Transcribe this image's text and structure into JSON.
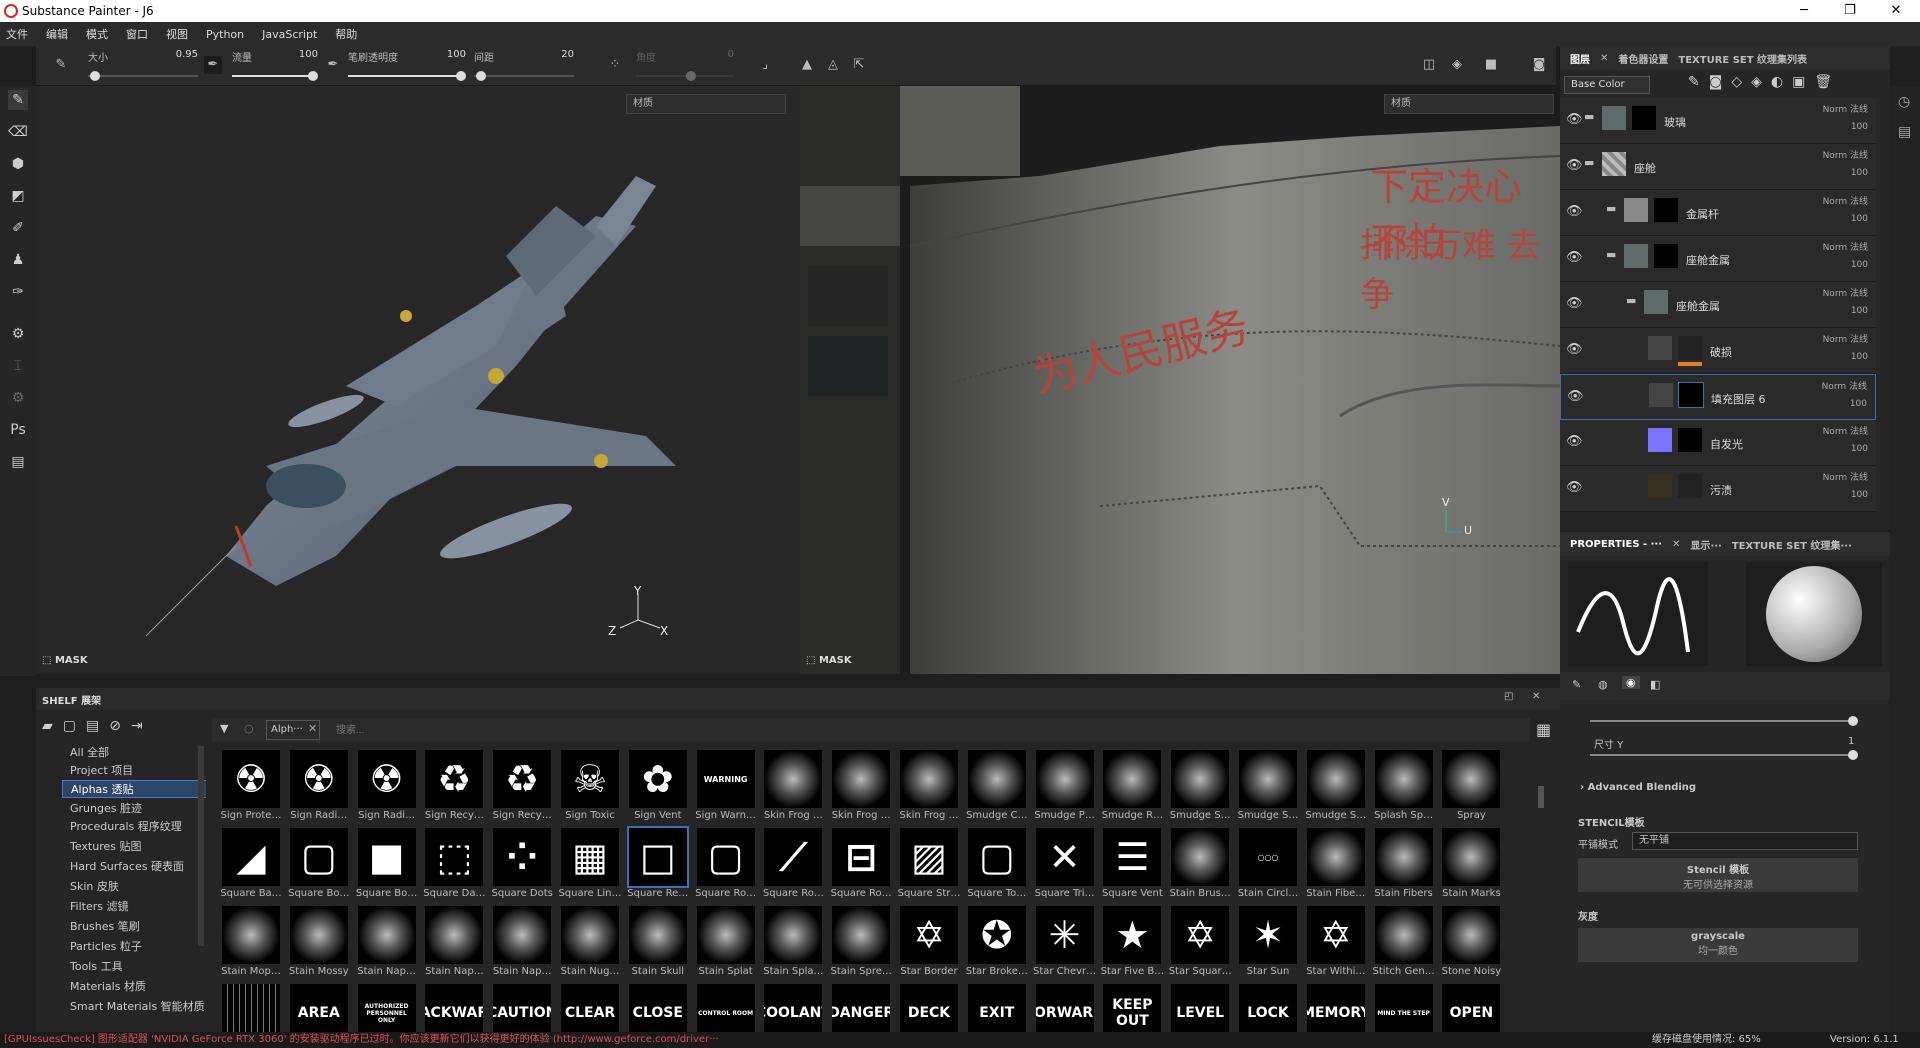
{
  "window": {
    "title": "Substance Painter - J6"
  },
  "menu": [
    "文件",
    "编辑",
    "模式",
    "窗口",
    "视图",
    "Python",
    "JavaScript",
    "帮助"
  ],
  "toolbar": {
    "size_label": "大小",
    "size_value": "0.95",
    "flow_label": "流量",
    "flow_value": "100",
    "stroke_opacity_label": "笔刷透明度",
    "stroke_opacity_value": "100",
    "spacing_label": "间距",
    "spacing_value": "20",
    "angle_label": "角度",
    "angle_value": "0"
  },
  "viewport3d": {
    "material_select": "材质",
    "mask_label": "MASK",
    "axis_y": "Y",
    "axis_x": "X",
    "axis_z": "Z"
  },
  "viewport2d": {
    "material_select": "材质",
    "mask_label": "MASK",
    "axis_v": "V",
    "axis_u": "U",
    "texture_text1": "下定决心  不怕",
    "texture_text2": "排除万难  去争",
    "texture_text3": "为人民服务"
  },
  "layers_panel": {
    "tabs": [
      "图层",
      "着色器设置",
      "TEXTURE SET 纹理集列表"
    ],
    "channel": "Base Color",
    "items": [
      {
        "name": "玻璃",
        "blend": "Norm 法线",
        "opacity": "100"
      },
      {
        "name": "座舱",
        "blend": "Norm 法线",
        "opacity": "100"
      },
      {
        "name": "金属杆",
        "blend": "Norm 法线",
        "opacity": "100"
      },
      {
        "name": "座舱金属",
        "blend": "Norm 法线",
        "opacity": "100"
      },
      {
        "name": "座舱金属",
        "blend": "Norm 法线",
        "opacity": "100"
      },
      {
        "name": "破损",
        "blend": "Norm 法线",
        "opacity": "100"
      },
      {
        "name": "填充图层 6",
        "blend": "Norm 法线",
        "opacity": "100"
      },
      {
        "name": "自发光",
        "blend": "Norm 法线",
        "opacity": "100"
      },
      {
        "name": "污渍",
        "blend": "Norm 法线",
        "opacity": "100"
      }
    ]
  },
  "properties": {
    "tabs": [
      "PROPERTIES - ···",
      "显示···",
      "TEXTURE SET 纹理集···"
    ],
    "size_y_label": "尺寸 Y",
    "size_y_value": "1",
    "advanced_blending": "Advanced Blending",
    "stencil_title": "STENCIL模板",
    "tile_mode_label": "平铺模式",
    "tile_mode_value": "无平铺",
    "stencil_button": "Stencil 模板",
    "stencil_sub": "无可供选择资源",
    "gray_title": "灰度",
    "gray_button": "grayscale",
    "gray_sub": "均一颜色"
  },
  "shelf": {
    "title": "SHELF 展架",
    "filter_tag": "Alph···",
    "search_placeholder": "搜索...",
    "categories": [
      "All 全部",
      "Project 项目",
      "Alphas 透贴",
      "Grunges 脏迹",
      "Procedurals 程序纹理",
      "Textures 贴图",
      "Hard Surfaces 硬表面",
      "Skin 皮肤",
      "Filters 滤镜",
      "Brushes 笔刷",
      "Particles 粒子",
      "Tools 工具",
      "Materials 材质",
      "Smart Materials 智能材质"
    ],
    "row1": [
      "Sign Prote…",
      "Sign Radi…",
      "Sign Radi…",
      "Sign Recy…",
      "Sign Recy…",
      "Sign Toxic",
      "Sign Vent",
      "Sign Warn…",
      "Skin Frog …",
      "Skin Frog …",
      "Skin Frog …",
      "Smudge C…",
      "Smudge P…",
      "Smudge R…",
      "Smudge S…",
      "Smudge S…",
      "Smudge S…",
      "Splash Sp…",
      "Spray"
    ],
    "row2": [
      "Square Ba…",
      "Square Bo…",
      "Square Bo…",
      "Square Da…",
      "Square Dots",
      "Square Lin…",
      "Square Re…",
      "Square Ro…",
      "Square Ro…",
      "Square Ro…",
      "Square Str…",
      "Square To…",
      "Square Tri…",
      "Square Vent",
      "Stain Brus…",
      "Stain Circl…",
      "Stain Fibe…",
      "Stain Fibers",
      "Stain Marks"
    ],
    "row3": [
      "Stain Mop…",
      "Stain Mossy",
      "Stain Nap…",
      "Stain Nap…",
      "Stain Nap…",
      "Stain Nug…",
      "Stain Skull",
      "Stain Splat",
      "Stain Spla…",
      "Stain Spre…",
      "Star Border",
      "Star Broke…",
      "Star Chevr…",
      "Star Five B…",
      "Star Squar…",
      "Star Sun",
      "Star Withi…",
      "Stitch Gen…",
      "Stone Noisy"
    ],
    "row4": [
      "",
      "AREA",
      "AUTHORIZED PERSONNEL ONLY",
      "BACKWARD",
      "CAUTION",
      "CLEAR",
      "CLOSE",
      "CONTROL ROOM",
      "COOLANT",
      "DANGER",
      "DECK",
      "EXIT",
      "FORWARD",
      "KEEP OUT",
      "LEVEL",
      "LOCK",
      "MEMORY",
      "MIND THE STEP",
      "OPEN"
    ],
    "row1_glyphs": [
      "☢",
      "☢",
      "☢",
      "♻",
      "♻",
      "☠",
      "✿",
      "WARNING",
      "",
      "",
      "",
      "",
      "",
      "",
      "",
      "",
      "",
      "",
      ""
    ],
    "row2_glyphs": [
      "◢",
      "▢",
      "■",
      "⬚",
      "⁘",
      "▦",
      "□",
      "▢",
      "⟋",
      "⊟",
      "▨",
      "▢",
      "✕",
      "☰",
      "",
      "○○○",
      "",
      "",
      ""
    ],
    "row3_glyphs": [
      "",
      "",
      "",
      "",
      "",
      "",
      "",
      "",
      "",
      "",
      "✡",
      "✪",
      "✳",
      "★",
      "✡",
      "✶",
      "✡",
      "",
      ""
    ]
  },
  "status": {
    "left": "[GPUIssuesCheck] 图形适配器 'NVIDIA GeForce RTX 3060' 的安装驱动程序已过时。你应该更新它们以获得更好的体验 (http://www.geforce.com/driver···",
    "disk": "缓存磁盘使用情况: 65%",
    "version": "Version: 6.1.1"
  }
}
